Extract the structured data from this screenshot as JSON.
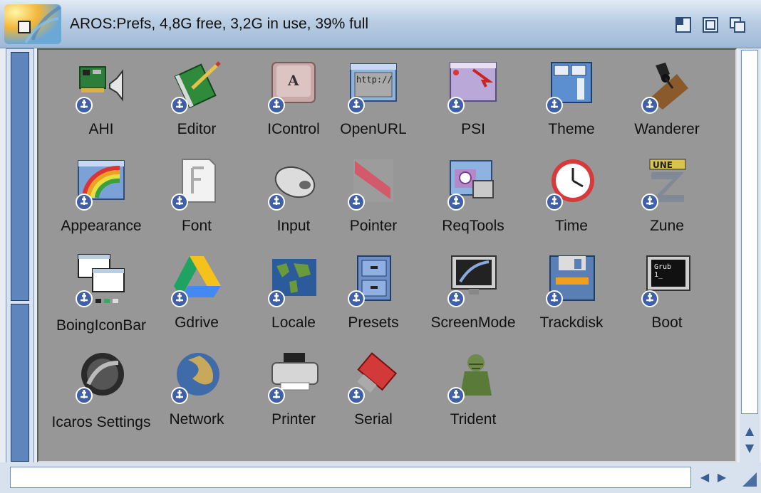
{
  "window": {
    "title": "AROS:Prefs,  4,8G free, 3,2G in use, 39% full"
  },
  "icons": [
    {
      "label": "AHI",
      "icon": "sound-card-icon"
    },
    {
      "label": "Editor",
      "icon": "notebook-pen-icon"
    },
    {
      "label": "IControl",
      "icon": "key-a-icon"
    },
    {
      "label": "OpenURL",
      "icon": "browser-window-icon"
    },
    {
      "label": "PSI",
      "icon": "screen-pointer-icon"
    },
    {
      "label": "Theme",
      "icon": "theme-window-icon"
    },
    {
      "label": "Wanderer",
      "icon": "desk-lamp-icon"
    },
    {
      "label": "Appearance",
      "icon": "rainbow-window-icon"
    },
    {
      "label": "Font",
      "icon": "font-page-icon"
    },
    {
      "label": "Input",
      "icon": "mouse-icon"
    },
    {
      "label": "Pointer",
      "icon": "pointer-arrow-icon"
    },
    {
      "label": "ReqTools",
      "icon": "requester-window-icon"
    },
    {
      "label": "Time",
      "icon": "clock-icon"
    },
    {
      "label": "Zune",
      "icon": "zune-logo-icon"
    },
    {
      "label": "BoingIconBar",
      "icon": "stacked-windows-icon"
    },
    {
      "label": "Gdrive",
      "icon": "google-drive-icon"
    },
    {
      "label": "Locale",
      "icon": "world-map-icon"
    },
    {
      "label": "Presets",
      "icon": "file-cabinet-icon"
    },
    {
      "label": "ScreenMode",
      "icon": "monitor-icon"
    },
    {
      "label": "Trackdisk",
      "icon": "floppy-disk-icon"
    },
    {
      "label": "Boot",
      "icon": "terminal-monitor-icon"
    },
    {
      "label": "Icaros Settings",
      "icon": "icaros-eye-icon"
    },
    {
      "label": "Network",
      "icon": "globe-icon"
    },
    {
      "label": "Printer",
      "icon": "printer-icon"
    },
    {
      "label": "Serial",
      "icon": "serial-plug-icon"
    },
    {
      "label": "Trident",
      "icon": "poseidon-statue-icon"
    }
  ],
  "boot_icon_text": "Grub\n1_",
  "openurl_icon_text": "http://",
  "zune_icon_text": "UNE",
  "colors": {
    "titlebar": "#b9cde3",
    "icon_background": "#979797",
    "scroller": "#5e86bd"
  }
}
